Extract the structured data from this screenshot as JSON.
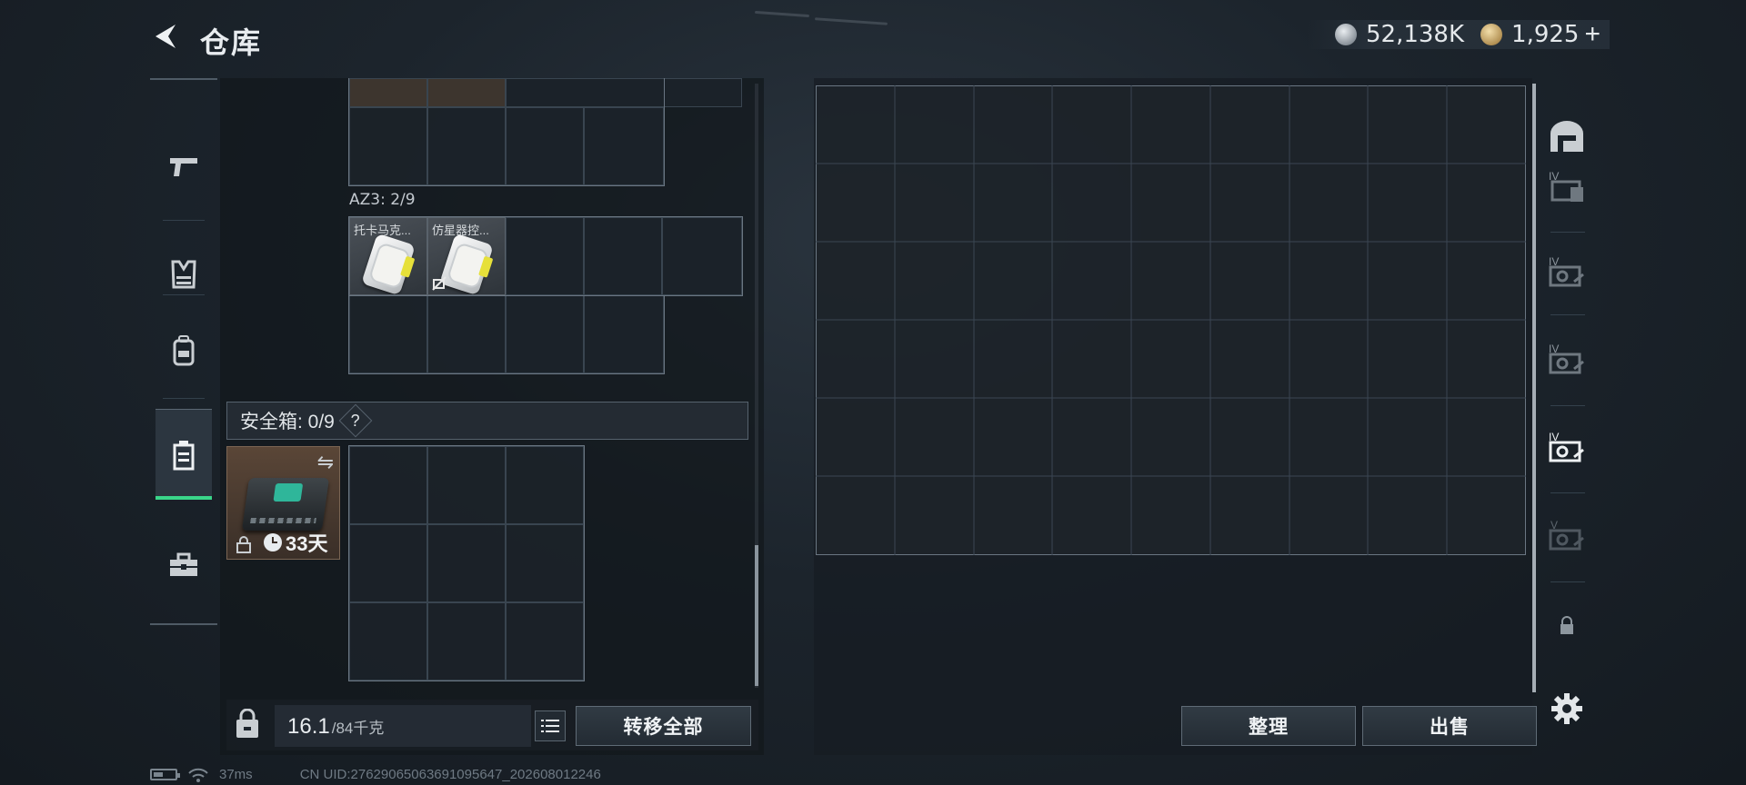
{
  "header": {
    "title": "仓库",
    "silver_amount": "52,138K",
    "gold_amount": "1,925",
    "add_symbol": "+"
  },
  "left_nav": {
    "items": [
      "pistol-icon",
      "vest-icon",
      "backpack-icon",
      "safe-box-icon",
      "toolbox-icon"
    ],
    "active": "safe-box-icon",
    "accent_color": "#3ad68a"
  },
  "containers": {
    "az3_label": "AZ3: 2/9",
    "az3_items": [
      {
        "name": "托卡马克..."
      },
      {
        "name": "仿星器控..."
      }
    ]
  },
  "safe_box": {
    "title": "安全箱: 0/9",
    "help": "?",
    "remaining": "33天"
  },
  "weight": {
    "current": "16.1",
    "max": "/84千克"
  },
  "buttons": {
    "transfer_all": "转移全部",
    "organize": "整理",
    "sell": "出售"
  },
  "right_nav": {
    "items": [
      "warehouse-icon",
      "tier-iv-1-icon",
      "tier-iv-2-icon",
      "tier-iv-3-icon",
      "tier-iv-4-icon",
      "tier-v-icon",
      "locked-icon"
    ]
  },
  "status_bar": {
    "ping": "37ms",
    "uid": "CN UID:27629065063691095647_202608012246"
  }
}
